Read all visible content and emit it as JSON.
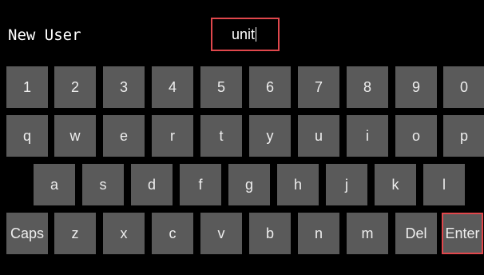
{
  "header": {
    "title": "New User"
  },
  "input": {
    "value": "unit"
  },
  "keyboard": {
    "row1": [
      "1",
      "2",
      "3",
      "4",
      "5",
      "6",
      "7",
      "8",
      "9",
      "0"
    ],
    "row2": [
      "q",
      "w",
      "e",
      "r",
      "t",
      "y",
      "u",
      "i",
      "o",
      "p"
    ],
    "row3": [
      "a",
      "s",
      "d",
      "f",
      "g",
      "h",
      "j",
      "k",
      "l"
    ],
    "row4": [
      "Caps",
      "z",
      "x",
      "c",
      "v",
      "b",
      "n",
      "m",
      "Del",
      "Enter"
    ]
  },
  "colors": {
    "background": "#000000",
    "key": "#5a5a5a",
    "key_text": "#eeeeee",
    "highlight": "#e0474c"
  }
}
